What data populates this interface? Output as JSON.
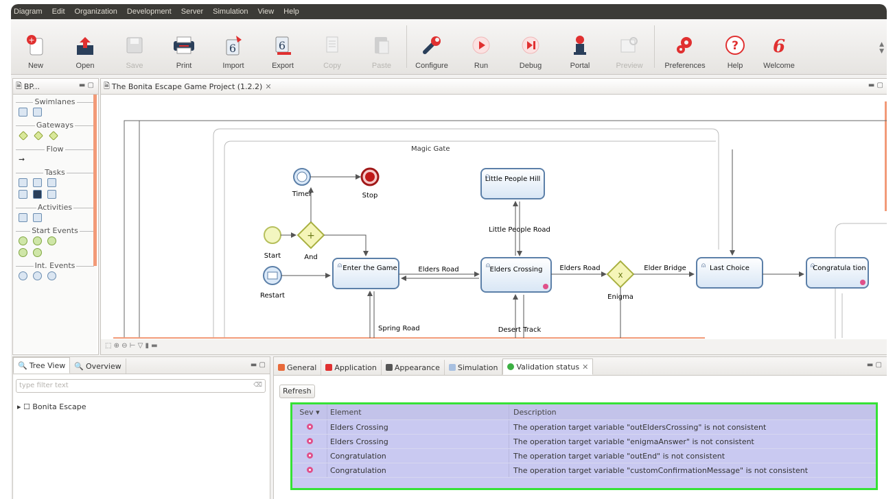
{
  "menu": [
    "Diagram",
    "Edit",
    "Organization",
    "Development",
    "Server",
    "Simulation",
    "View",
    "Help"
  ],
  "toolbar": [
    {
      "label": "New",
      "icon": "new-icon",
      "enabled": true
    },
    {
      "label": "Open",
      "icon": "open-icon",
      "enabled": true
    },
    {
      "label": "Save",
      "icon": "save-icon",
      "enabled": false
    },
    {
      "label": "Print",
      "icon": "print-icon",
      "enabled": true
    },
    {
      "label": "Import",
      "icon": "import-icon",
      "enabled": true
    },
    {
      "label": "Export",
      "icon": "export-icon",
      "enabled": true
    },
    {
      "label": "Copy",
      "icon": "copy-icon",
      "enabled": false
    },
    {
      "label": "Paste",
      "icon": "paste-icon",
      "enabled": false
    },
    {
      "label": "Configure",
      "icon": "configure-icon",
      "enabled": true
    },
    {
      "label": "Run",
      "icon": "run-icon",
      "enabled": true
    },
    {
      "label": "Debug",
      "icon": "debug-icon",
      "enabled": true
    },
    {
      "label": "Portal",
      "icon": "portal-icon",
      "enabled": true
    },
    {
      "label": "Preview",
      "icon": "preview-icon",
      "enabled": false
    },
    {
      "label": "Preferences",
      "icon": "preferences-icon",
      "enabled": true
    },
    {
      "label": "Help",
      "icon": "help-icon",
      "enabled": true
    },
    {
      "label": "Welcome",
      "icon": "welcome-icon",
      "enabled": true
    }
  ],
  "palette": {
    "tab_label": "BP...",
    "categories": [
      "Swimlanes",
      "Gateways",
      "Flow",
      "Tasks",
      "Activities",
      "Start Events",
      "Int. Events"
    ]
  },
  "editor": {
    "tab_label": "The Bonita Escape Game Project (1.2.2)"
  },
  "diagram": {
    "pool_label": "Magic Gate",
    "tasks": {
      "enter_game": "Enter the Game",
      "little_people_hill": "Little People Hill",
      "elders_crossing": "Elders Crossing",
      "last_choice": "Last Choice",
      "congratulation": "Congratula tion"
    },
    "events": {
      "start": "Start",
      "restart": "Restart",
      "timer": "Timer",
      "stop": "Stop"
    },
    "gateways": {
      "and": "And",
      "enigma": "Enigma"
    },
    "flows": {
      "elders_road_1": "Elders Road",
      "elders_road_2": "Elders Road",
      "elder_bridge": "Elder Bridge",
      "little_people_road": "Little People Road",
      "spring_road": "Spring Road",
      "desert_track": "Desert Track"
    }
  },
  "treeview": {
    "tabs": [
      "Tree View",
      "Overview"
    ],
    "filter_placeholder": "type filter text",
    "root_item": "Bonita Escape"
  },
  "properties": {
    "tabs": [
      "General",
      "Application",
      "Appearance",
      "Simulation",
      "Validation status"
    ],
    "refresh_label": "Refresh",
    "columns": [
      "Sev",
      "Element",
      "Description"
    ],
    "rows": [
      {
        "element": "Elders Crossing",
        "description": "The operation target variable \"outEldersCrossing\" is not consistent"
      },
      {
        "element": "Elders Crossing",
        "description": "The operation target variable \"enigmaAnswer\" is not consistent"
      },
      {
        "element": "Congratulation",
        "description": "The operation target variable \"outEnd\" is not consistent"
      },
      {
        "element": "Congratulation",
        "description": "The operation target variable \"customConfirmationMessage\" is not consistent"
      }
    ]
  },
  "colors": {
    "highlight": "#35e235",
    "table_bg": "#c9c9f1",
    "error": "#e0508a",
    "scrollbar": "#f29a78"
  }
}
